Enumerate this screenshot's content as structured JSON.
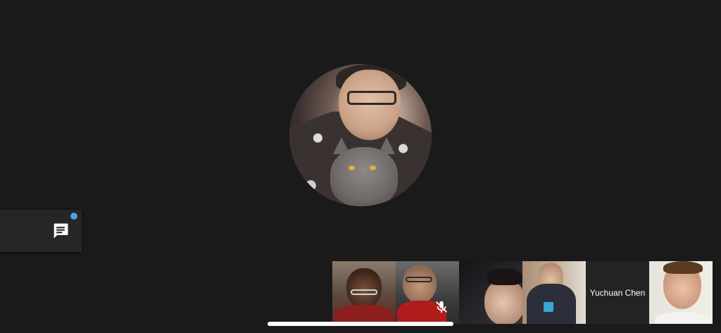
{
  "call": {
    "main_speaker_avatar": "participant-avatar-photo",
    "chat": {
      "icon": "chat-icon",
      "has_unread": true,
      "accent_color": "#4aa3df"
    },
    "participants": [
      {
        "type": "video",
        "icon": "participant-video"
      },
      {
        "type": "video",
        "icon": "participant-video",
        "muted": true,
        "mute_icon": "mic-off-icon"
      },
      {
        "type": "video",
        "icon": "participant-video"
      },
      {
        "type": "video",
        "icon": "participant-video"
      },
      {
        "type": "name",
        "name": "Yuchuan Chen"
      },
      {
        "type": "video",
        "icon": "participant-video"
      }
    ]
  }
}
